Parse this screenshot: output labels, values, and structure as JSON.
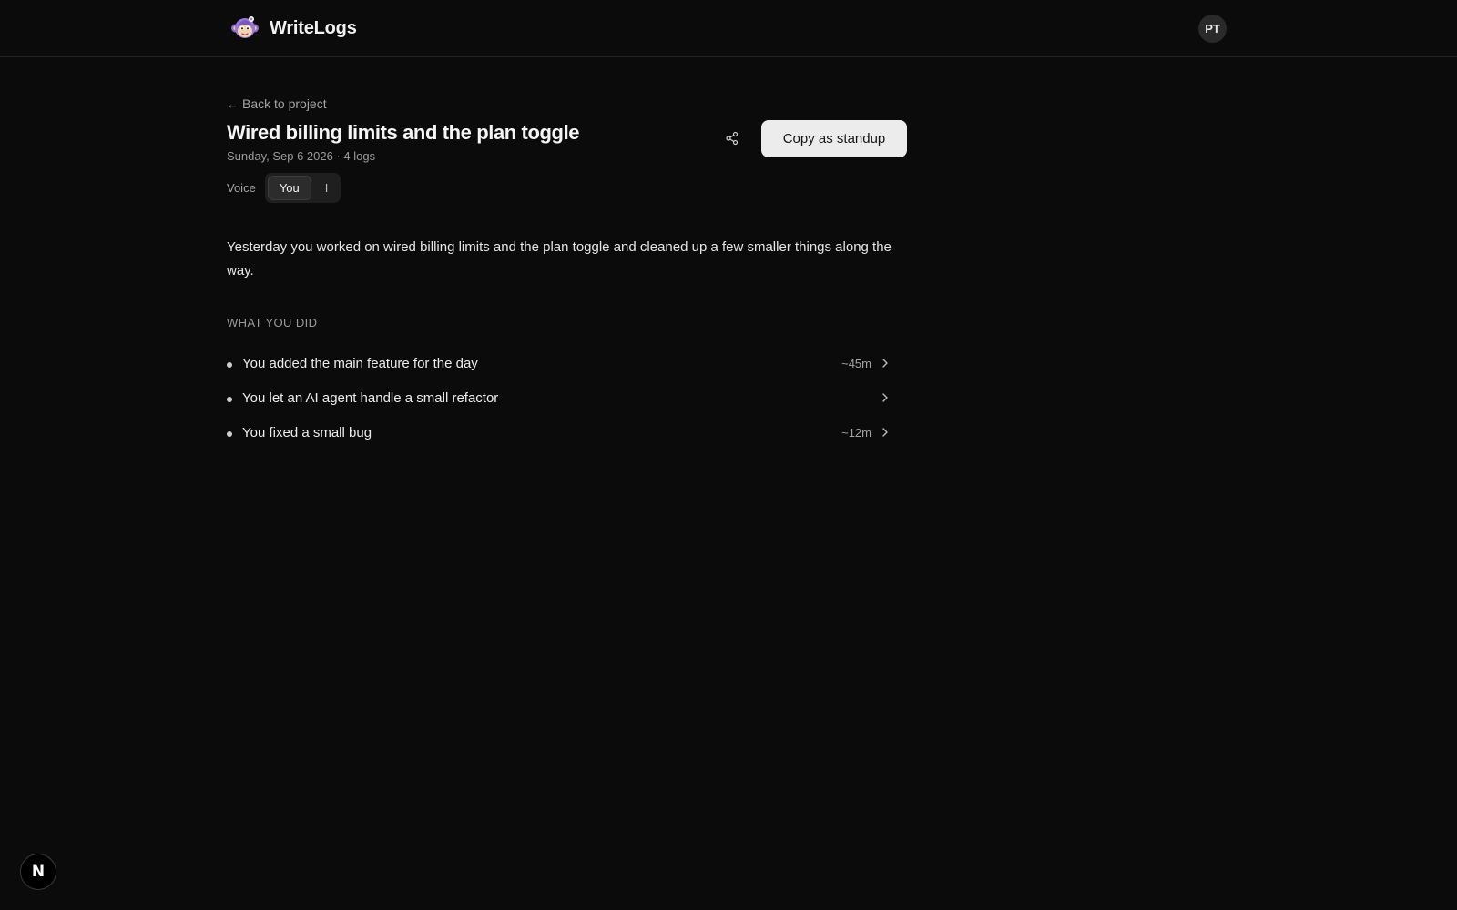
{
  "header": {
    "brand_name": "WriteLogs",
    "logo_icon": "monkey-mascot-icon",
    "avatar_initials": "PT"
  },
  "page": {
    "back_label": "Back to project",
    "back_icon": "arrow-left-icon",
    "title": "Wired billing limits and the plan toggle",
    "meta": "Sunday, Sep 6 2026 · 4 logs",
    "share_icon": "share-icon",
    "copy_button_label": "Copy as standup"
  },
  "voice": {
    "label": "Voice",
    "options": [
      "You",
      "I"
    ],
    "selected": "You"
  },
  "summary": "Yesterday you worked on wired billing limits and the plan toggle and cleaned up a few smaller things along the way.",
  "section": {
    "heading": "WHAT YOU DID",
    "items": [
      {
        "text": "You added the main feature for the day",
        "duration": "~45m"
      },
      {
        "text": "You let an AI agent handle a small refactor",
        "duration": ""
      },
      {
        "text": "You fixed a small bug",
        "duration": "~12m"
      }
    ]
  },
  "corner_badge": {
    "letter": "N",
    "icon": "nextjs-devtools-icon"
  },
  "colors": {
    "background": "#0b0b0b",
    "primary_button": "#ececec",
    "muted_text": "#a3a3a3",
    "accent_logo": "#8b6cc7"
  }
}
